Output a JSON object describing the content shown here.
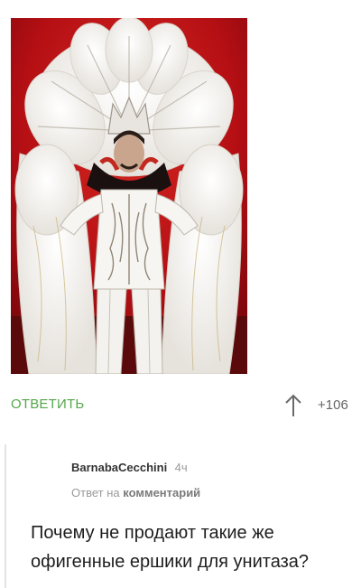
{
  "post": {
    "image_alt_icon": "photo-costume",
    "colors": {
      "background": "#b80d12",
      "feathers": "#f4f1ee",
      "accent_link": "#54a74a"
    }
  },
  "actions": {
    "reply_label": "ОТВЕТИТЬ",
    "vote_icon": "arrow-up-icon",
    "rating": "+106",
    "more": "."
  },
  "reply_comment": {
    "author": "BarnabaCecchini",
    "time": "4ч",
    "reply_prefix": "Ответ на",
    "reply_target": "комментарий",
    "text": "Почему не продают такие же офигенные ершики для унитаза?"
  }
}
